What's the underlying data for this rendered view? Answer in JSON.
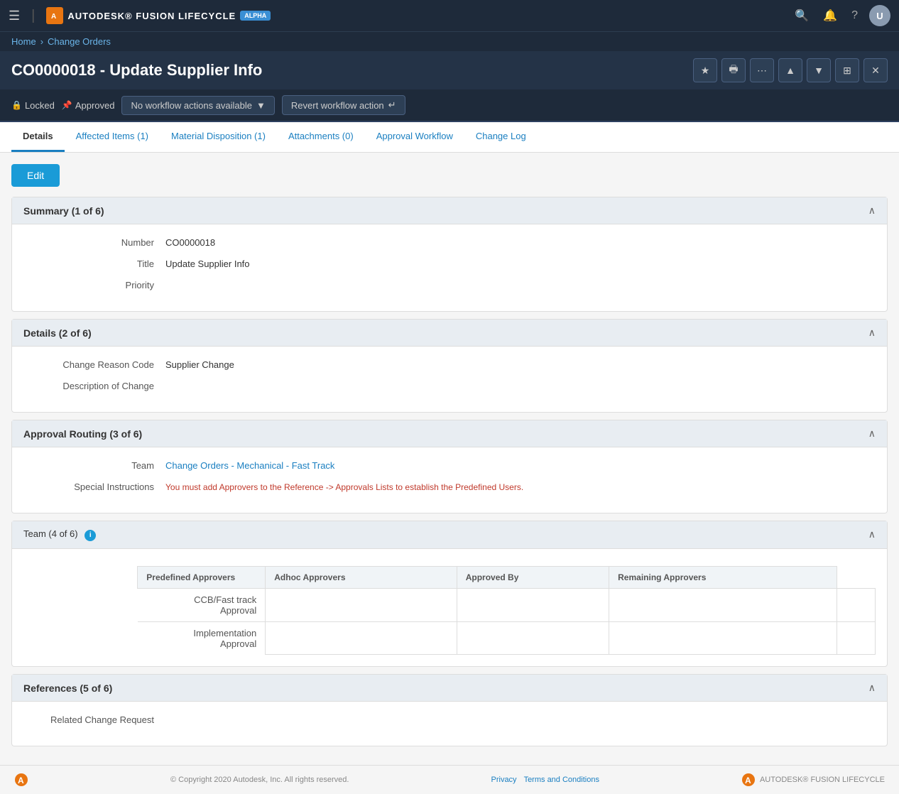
{
  "topnav": {
    "brand_name": "AUTODESK® FUSION LIFECYCLE",
    "alpha_label": "ALPHA",
    "nav_icons": [
      "search-icon",
      "bell-icon",
      "help-icon"
    ]
  },
  "breadcrumb": {
    "home": "Home",
    "separator": "›",
    "current": "Change Orders"
  },
  "page": {
    "title": "CO0000018 - Update Supplier Info",
    "header_buttons": [
      "star-icon",
      "print-icon",
      "more-icon",
      "up-icon",
      "down-icon",
      "grid-icon",
      "close-icon"
    ]
  },
  "status": {
    "locked_label": "Locked",
    "approved_label": "Approved",
    "workflow_dropdown_label": "No workflow actions available",
    "revert_label": "Revert workflow action"
  },
  "tabs": [
    {
      "id": "details",
      "label": "Details",
      "active": true
    },
    {
      "id": "affected-items",
      "label": "Affected Items (1)",
      "active": false
    },
    {
      "id": "material-disposition",
      "label": "Material Disposition (1)",
      "active": false
    },
    {
      "id": "attachments",
      "label": "Attachments (0)",
      "active": false
    },
    {
      "id": "approval-workflow",
      "label": "Approval Workflow",
      "active": false
    },
    {
      "id": "change-log",
      "label": "Change Log",
      "active": false
    }
  ],
  "edit_button": "Edit",
  "sections": {
    "summary": {
      "title": "Summary (1 of 6)",
      "fields": {
        "number_label": "Number",
        "number_value": "CO0000018",
        "title_label": "Title",
        "title_value": "Update Supplier Info",
        "priority_label": "Priority",
        "priority_value": ""
      }
    },
    "details": {
      "title": "Details (2 of 6)",
      "fields": {
        "change_reason_label": "Change Reason Code",
        "change_reason_value": "Supplier Change",
        "description_label": "Description of Change",
        "description_value": ""
      }
    },
    "approval_routing": {
      "title": "Approval Routing (3 of 6)",
      "fields": {
        "team_label": "Team",
        "team_value": "Change Orders - Mechanical - Fast Track",
        "special_instructions_label": "Special Instructions",
        "special_instructions_value": "You must add Approvers to the Reference -> Approvals Lists to establish the Predefined Users."
      }
    },
    "team": {
      "title": "Team (4 of 6)",
      "columns": [
        "Predefined Approvers",
        "Adhoc Approvers",
        "Approved By",
        "Remaining Approvers"
      ],
      "rows": [
        {
          "label": "CCB/Fast track Approval",
          "predefined": "",
          "adhoc": "",
          "approved_by": "",
          "remaining": ""
        },
        {
          "label": "Implementation Approval",
          "predefined": "",
          "adhoc": "",
          "approved_by": "",
          "remaining": ""
        }
      ]
    },
    "references": {
      "title": "References (5 of 6)",
      "fields": {
        "related_change_label": "Related Change Request",
        "related_change_value": ""
      }
    }
  },
  "footer": {
    "copyright": "© Copyright 2020 Autodesk, Inc. All rights reserved.",
    "privacy_label": "Privacy",
    "terms_label": "Terms and Conditions",
    "brand": "AUTODESK® FUSION LIFECYCLE"
  }
}
